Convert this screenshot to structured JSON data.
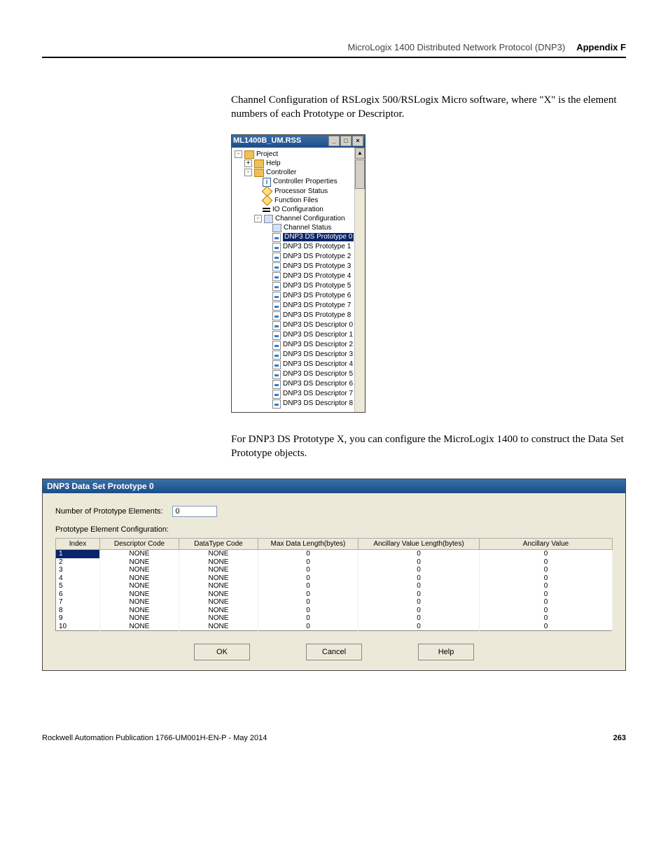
{
  "header": {
    "running_head": "MicroLogix 1400 Distributed Network Protocol (DNP3)",
    "appendix": "Appendix F"
  },
  "paragraph1": "Channel Configuration of RSLogix 500/RSLogix Micro software, where \"X\" is the element numbers of each Prototype or Descriptor.",
  "paragraph2": "For DNP3 DS Prototype X, you can configure the MicroLogix 1400 to construct the Data Set Prototype objects.",
  "tree": {
    "title": "ML1400B_UM.RSS",
    "root": "Project",
    "help": "Help",
    "controller": "Controller",
    "controller_items": {
      "properties": "Controller Properties",
      "processor_status": "Processor Status",
      "function_files": "Function Files",
      "io_config": "IO Configuration",
      "channel_config": "Channel Configuration",
      "channel_status": "Channel Status"
    },
    "channel_children": [
      "DNP3 DS Prototype 0",
      "DNP3 DS Prototype 1",
      "DNP3 DS Prototype 2",
      "DNP3 DS Prototype 3",
      "DNP3 DS Prototype 4",
      "DNP3 DS Prototype 5",
      "DNP3 DS Prototype 6",
      "DNP3 DS Prototype 7",
      "DNP3 DS Prototype 8",
      "DNP3 DS Descriptor 0",
      "DNP3 DS Descriptor 1",
      "DNP3 DS Descriptor 2",
      "DNP3 DS Descriptor 3",
      "DNP3 DS Descriptor 4",
      "DNP3 DS Descriptor 5",
      "DNP3 DS Descriptor 6",
      "DNP3 DS Descriptor 7",
      "DNP3 DS Descriptor 8"
    ],
    "selected_index": 0
  },
  "dialog": {
    "title": "DNP3 Data Set Prototype 0",
    "num_elements_label": "Number of Prototype Elements:",
    "num_elements_value": "0",
    "config_label": "Prototype Element Configuration:",
    "columns": [
      "Index",
      "Descriptor Code",
      "DataType Code",
      "Max Data Length(bytes)",
      "Ancillary Value Length(bytes)",
      "Ancillary Value"
    ],
    "rows": [
      {
        "idx": "1",
        "dc": "NONE",
        "dtc": "NONE",
        "mdl": "0",
        "avl": "0",
        "av": "0"
      },
      {
        "idx": "2",
        "dc": "NONE",
        "dtc": "NONE",
        "mdl": "0",
        "avl": "0",
        "av": "0"
      },
      {
        "idx": "3",
        "dc": "NONE",
        "dtc": "NONE",
        "mdl": "0",
        "avl": "0",
        "av": "0"
      },
      {
        "idx": "4",
        "dc": "NONE",
        "dtc": "NONE",
        "mdl": "0",
        "avl": "0",
        "av": "0"
      },
      {
        "idx": "5",
        "dc": "NONE",
        "dtc": "NONE",
        "mdl": "0",
        "avl": "0",
        "av": "0"
      },
      {
        "idx": "6",
        "dc": "NONE",
        "dtc": "NONE",
        "mdl": "0",
        "avl": "0",
        "av": "0"
      },
      {
        "idx": "7",
        "dc": "NONE",
        "dtc": "NONE",
        "mdl": "0",
        "avl": "0",
        "av": "0"
      },
      {
        "idx": "8",
        "dc": "NONE",
        "dtc": "NONE",
        "mdl": "0",
        "avl": "0",
        "av": "0"
      },
      {
        "idx": "9",
        "dc": "NONE",
        "dtc": "NONE",
        "mdl": "0",
        "avl": "0",
        "av": "0"
      },
      {
        "idx": "10",
        "dc": "NONE",
        "dtc": "NONE",
        "mdl": "0",
        "avl": "0",
        "av": "0"
      }
    ],
    "buttons": {
      "ok": "OK",
      "cancel": "Cancel",
      "help": "Help"
    }
  },
  "footer": {
    "publication": "Rockwell Automation Publication 1766-UM001H-EN-P - May 2014",
    "page_number": "263"
  }
}
